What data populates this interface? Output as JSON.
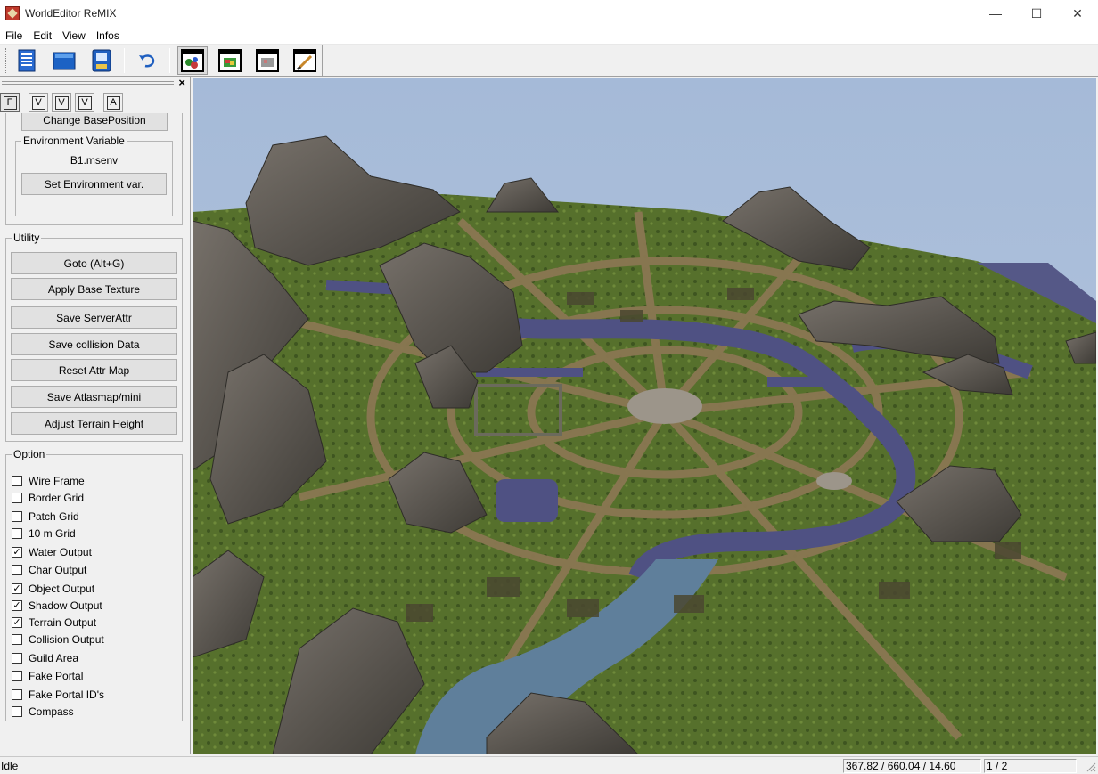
{
  "window": {
    "title": "WorldEditor ReMIX",
    "minimize": "—",
    "maximize": "☐",
    "close": "✕"
  },
  "menu": [
    "File",
    "Edit",
    "View",
    "Infos"
  ],
  "toolbar": {
    "buttons": [
      "new-document-icon",
      "open-folder-icon",
      "save-disk-icon",
      "undo-icon",
      "object-view-icon",
      "texture-view-icon",
      "attribute-view-icon",
      "brush-edit-icon"
    ]
  },
  "panel": {
    "close": "×",
    "tabs": [
      "F",
      "V",
      "V",
      "V",
      "A"
    ],
    "change_base_position": "Change BasePosition",
    "env_group_label": "Environment Variable",
    "env_file": "B1.msenv",
    "set_env_button": "Set Environment var.",
    "utility_label": "Utility",
    "utility_buttons": [
      "Goto (Alt+G)",
      "Apply Base Texture",
      "Save ServerAttr",
      "Save collision Data",
      "Reset Attr Map",
      "Save Atlasmap/mini",
      "Adjust Terrain Height"
    ],
    "option_label": "Option",
    "options": [
      {
        "label": "Wire Frame",
        "checked": false
      },
      {
        "label": "Border Grid",
        "checked": false
      },
      {
        "label": "Patch Grid",
        "checked": false
      },
      {
        "label": "10 m Grid",
        "checked": false
      },
      {
        "label": "Water Output",
        "checked": true
      },
      {
        "label": "Char Output",
        "checked": false
      },
      {
        "label": "Object Output",
        "checked": true
      },
      {
        "label": "Shadow Output",
        "checked": true
      },
      {
        "label": "Terrain Output",
        "checked": true
      },
      {
        "label": "Collision Output",
        "checked": false
      },
      {
        "label": "Guild Area",
        "checked": false
      },
      {
        "label": "Fake Portal",
        "checked": false
      },
      {
        "label": "Fake Portal ID's",
        "checked": false
      },
      {
        "label": "Compass",
        "checked": false
      }
    ]
  },
  "status": {
    "text": "Idle",
    "coords": "367.82 / 660.04 / 14.60",
    "page": "1 / 2"
  },
  "colors": {
    "sky": "#a9bcd6",
    "grass": "#56702c",
    "path": "#8c7a55",
    "water": "#4b4e7e",
    "river": "#5f7f9b",
    "rock": "#5a564f"
  }
}
